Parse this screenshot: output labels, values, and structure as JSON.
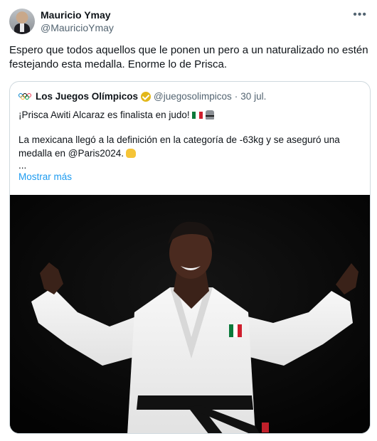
{
  "tweet": {
    "author_name": "Mauricio Ymay",
    "author_handle": "@MauricioYmay",
    "more_icon": "more-options-icon",
    "text": "Espero que todos aquellos que le ponen un pero a un naturalizado no estén festejando esta medalla. Enorme lo de Prisca."
  },
  "quoted": {
    "author_name": "Los Juegos Olímpicos",
    "author_handle": "@juegosolimpicos",
    "separator": "·",
    "date": "30 jul.",
    "line1": "¡Prisca Awiti Alcaraz es finalista en judo!",
    "line2": "La mexicana llegó a la definición en la categoría de -63kg y se aseguró una medalla en @Paris2024.",
    "ellipsis": "...",
    "show_more": "Mostrar más",
    "icons": [
      "olympic-rings-icon",
      "verified-badge-icon",
      "mexico-flag-icon",
      "judo-icon",
      "clapping-hands-icon"
    ]
  },
  "colors": {
    "text": "#0f1419",
    "secondary": "#536471",
    "link": "#1d9bf0",
    "border": "#cfd9de",
    "verified_gold": "#e2b719"
  }
}
